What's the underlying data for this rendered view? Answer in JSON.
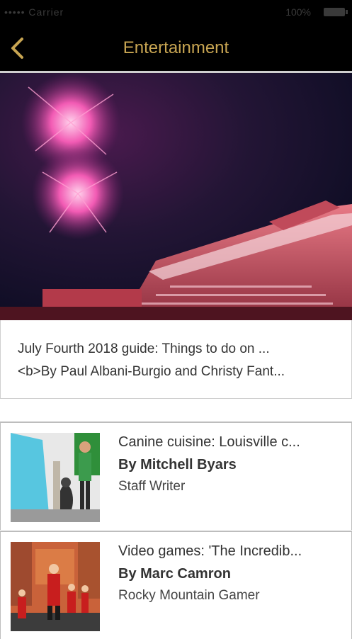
{
  "status_bar": {
    "carrier": "••••• Carrier",
    "battery": "100%"
  },
  "header": {
    "back_icon": "chevron-left-icon",
    "title": "Entertainment",
    "accent_color": "#c8a552"
  },
  "featured": {
    "image": "fireworks-over-stadium",
    "title": "July Fourth 2018 guide: Things to do on ...",
    "subtitle": "<b>By Paul Albani-Burgio and Christy Fant..."
  },
  "articles": [
    {
      "image": "dog-with-person",
      "title": "Canine cuisine: Louisville c...",
      "author": "By Mitchell Byars",
      "role": "Staff Writer"
    },
    {
      "image": "incredibles-characters",
      "title": "Video games: 'The Incredib...",
      "author": "By Marc Camron",
      "role": "Rocky Mountain Gamer"
    }
  ]
}
